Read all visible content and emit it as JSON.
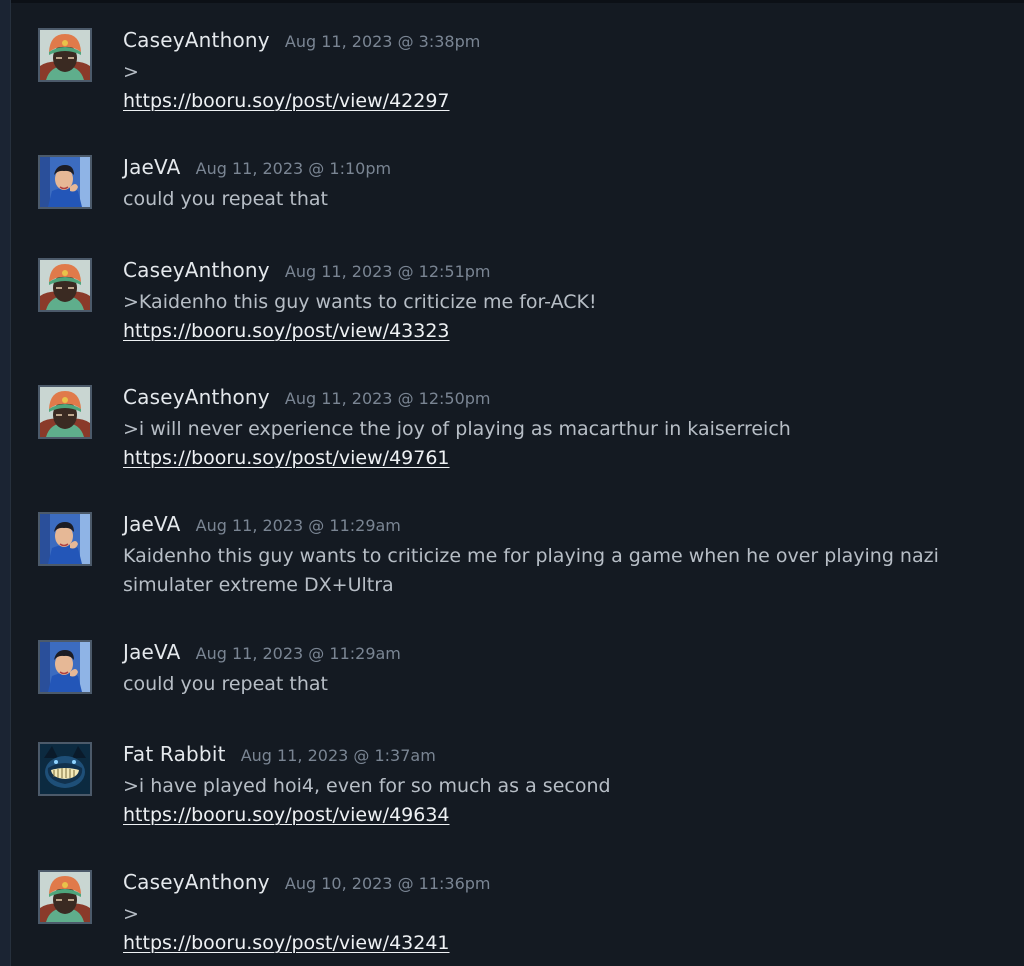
{
  "comments": [
    {
      "author": "CaseyAnthony",
      "timestamp": "Aug 11, 2023 @ 3:38pm",
      "avatar": "casey-avatar",
      "text": ">",
      "text2": "",
      "link": "https://booru.soy/post/view/42297"
    },
    {
      "author": "JaeVA",
      "timestamp": "Aug 11, 2023 @ 1:10pm",
      "avatar": "jae-avatar",
      "text": "could you repeat that",
      "text2": "",
      "link": ""
    },
    {
      "author": "CaseyAnthony",
      "timestamp": "Aug 11, 2023 @ 12:51pm",
      "avatar": "casey-avatar",
      "text": ">Kaidenho this guy wants to criticize me for-ACK!",
      "text2": "",
      "link": "https://booru.soy/post/view/43323"
    },
    {
      "author": "CaseyAnthony",
      "timestamp": "Aug 11, 2023 @ 12:50pm",
      "avatar": "casey-avatar",
      "text": ">i will never experience the joy of playing as macarthur in kaiserreich",
      "text2": "",
      "link": "https://booru.soy/post/view/49761"
    },
    {
      "author": "JaeVA",
      "timestamp": "Aug 11, 2023 @ 11:29am",
      "avatar": "jae-avatar",
      "text": "Kaidenho this guy wants to criticize me for playing a game when he over playing nazi",
      "text2": "simulater extreme DX+Ultra",
      "link": ""
    },
    {
      "author": "JaeVA",
      "timestamp": "Aug 11, 2023 @ 11:29am",
      "avatar": "jae-avatar",
      "text": "could you repeat that",
      "text2": "",
      "link": ""
    },
    {
      "author": "Fat Rabbit",
      "timestamp": "Aug 11, 2023 @ 1:37am",
      "avatar": "fat-rabbit-avatar",
      "text": ">i have played hoi4, even for so much as a second",
      "text2": "",
      "link": "https://booru.soy/post/view/49634"
    },
    {
      "author": "CaseyAnthony",
      "timestamp": "Aug 10, 2023 @ 11:36pm",
      "avatar": "casey-avatar",
      "text": ">",
      "text2": "",
      "link": "https://booru.soy/post/view/43241"
    }
  ],
  "colors": {
    "background": "#141a22",
    "author": "#e4e8ec",
    "timestamp": "#7a8593",
    "text": "#b7bec6",
    "link": "#eef1f4"
  }
}
